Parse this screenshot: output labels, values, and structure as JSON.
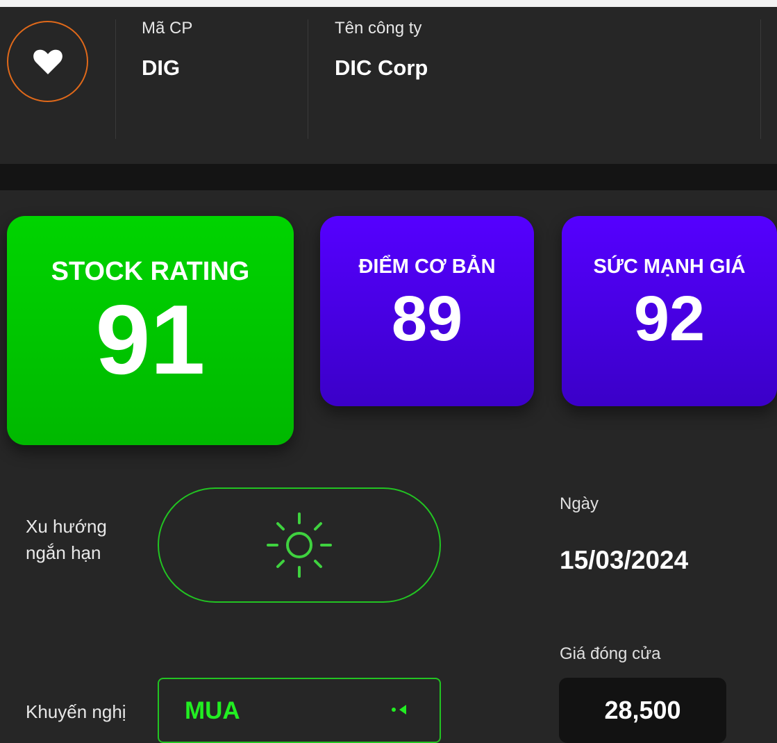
{
  "header": {
    "favorite_icon": "heart-icon",
    "symbol_label": "Mã CP",
    "symbol_value": "DIG",
    "company_label": "Tên công ty",
    "company_value": "DIC Corp"
  },
  "scores": {
    "stock_rating": {
      "title": "STOCK RATING",
      "value": "91"
    },
    "fundamental": {
      "title": "ĐIỂM CƠ BẢN",
      "value": "89"
    },
    "price_strength": {
      "title": "SỨC MẠNH GIÁ",
      "value": "92"
    }
  },
  "trend": {
    "label_line1": "Xu hướng",
    "label_line2": "ngắn hạn",
    "icon": "sun-icon"
  },
  "recommendation": {
    "label": "Khuyến nghị",
    "value": "MUA",
    "indicator_icon": "dot-arrow-left-icon"
  },
  "date": {
    "label": "Ngày",
    "value": "15/03/2024"
  },
  "close_price": {
    "label": "Giá đóng cửa",
    "value": "28,500"
  },
  "colors": {
    "background": "#262626",
    "green_card": "#00c800",
    "purple_card": "#4a00e8",
    "accent_green": "#22c422",
    "favorite_ring": "#e0691a"
  }
}
